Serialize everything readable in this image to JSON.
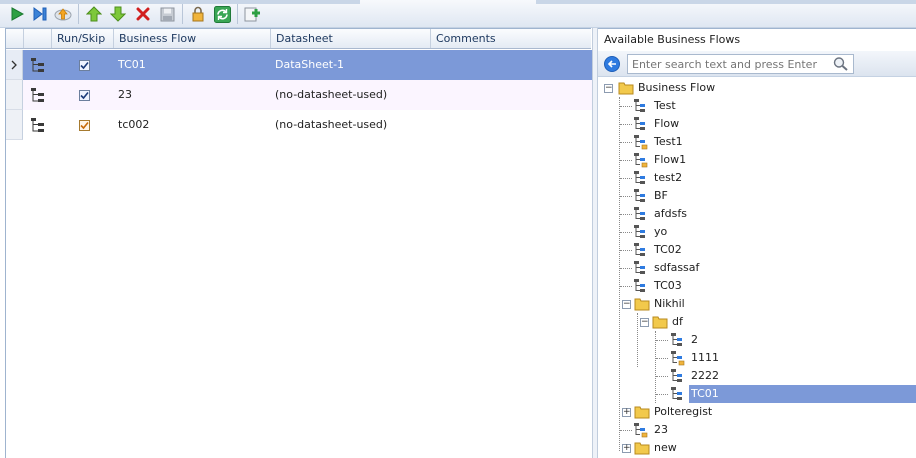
{
  "toolbar": {
    "buttons": [
      {
        "name": "run-icon"
      },
      {
        "name": "step-forward-icon"
      },
      {
        "name": "upload-icon"
      },
      {
        "name": "move-up-icon"
      },
      {
        "name": "move-down-icon"
      },
      {
        "name": "delete-icon"
      },
      {
        "name": "save-icon"
      },
      {
        "name": "lock-icon"
      },
      {
        "name": "refresh-icon"
      },
      {
        "name": "add-icon"
      }
    ]
  },
  "grid": {
    "columns": {
      "run_skip": "Run/Skip",
      "business_flow": "Business Flow",
      "datasheet": "Datasheet",
      "comments": "Comments"
    },
    "rows": [
      {
        "business_flow": "TC01",
        "datasheet": "DataSheet-1",
        "comments": "",
        "checked": true
      },
      {
        "business_flow": "23",
        "datasheet": "(no-datasheet-used)",
        "comments": "",
        "checked": true
      },
      {
        "business_flow": "tc002",
        "datasheet": "(no-datasheet-used)",
        "comments": "",
        "checked": true
      }
    ]
  },
  "panel": {
    "title": "Available Business Flows",
    "search_placeholder": "Enter search text and press Enter"
  },
  "tree": {
    "root": "Business Flow",
    "flows": [
      "Test",
      "Flow",
      "Test1",
      "Flow1",
      "test2",
      "BF",
      "afdsfs",
      "yo",
      "TC02",
      "sdfassaf",
      "TC03"
    ],
    "nikhil": "Nikhil",
    "df": "df",
    "df_children": [
      "2",
      "1111",
      "2222",
      "TC01"
    ],
    "polteregist": "Polteregist",
    "item_23": "23",
    "new": "new"
  },
  "colors": {
    "selection": "#7c99d8",
    "folder": "#f2c94c",
    "accent_green": "#2ea043",
    "accent_red": "#d11f1f"
  }
}
